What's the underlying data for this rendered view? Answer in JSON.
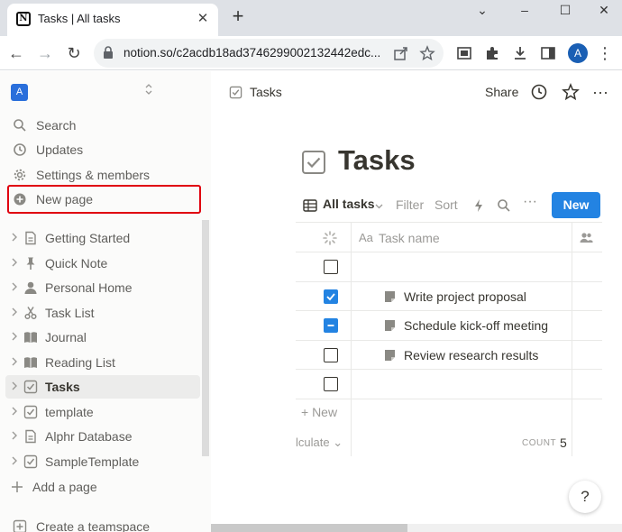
{
  "browser": {
    "tab_title": "Tasks | All tasks",
    "favicon_letter": "N",
    "url": "notion.so/c2acdb18ad3746299002132442edc...",
    "profile_initial": "A"
  },
  "sidebar": {
    "workspace_initial": "A",
    "workspace_switch": "⌃⌄",
    "menu": [
      {
        "label": "Search",
        "icon": "search-icon"
      },
      {
        "label": "Updates",
        "icon": "clock-icon"
      },
      {
        "label": "Settings & members",
        "icon": "gear-icon"
      },
      {
        "label": "New page",
        "icon": "plus-circle-icon"
      }
    ],
    "pages": [
      {
        "label": "Getting Started",
        "icon": "document-icon"
      },
      {
        "label": "Quick Note",
        "icon": "pin-icon"
      },
      {
        "label": "Personal Home",
        "icon": "person-icon"
      },
      {
        "label": "Task List",
        "icon": "scissors-icon"
      },
      {
        "label": "Journal",
        "icon": "book-icon"
      },
      {
        "label": "Reading List",
        "icon": "book-icon"
      },
      {
        "label": "Tasks",
        "icon": "checkbox-icon",
        "active": true
      },
      {
        "label": "template",
        "icon": "checkbox-icon"
      },
      {
        "label": "Alphr Database",
        "icon": "document-icon"
      },
      {
        "label": "SampleTemplate",
        "icon": "checkbox-icon"
      }
    ],
    "add_page": "Add a page",
    "create_teamspace": "Create a teamspace"
  },
  "main": {
    "breadcrumb": "Tasks",
    "share": "Share",
    "title": "Tasks",
    "view": {
      "tab": "All tasks",
      "filter": "Filter",
      "sort": "Sort",
      "new_button": "New"
    },
    "table": {
      "name_header": "Task name",
      "name_header_prefix": "Aa",
      "rows": [
        {
          "checked": "none",
          "name": ""
        },
        {
          "checked": "checked",
          "name": "Write project proposal"
        },
        {
          "checked": "partial",
          "name": "Schedule kick-off meeting"
        },
        {
          "checked": "none",
          "name": "Review research results"
        },
        {
          "checked": "none",
          "name": ""
        }
      ],
      "add_row": "+ New",
      "calculate": "lculate ⌄",
      "count_label": "COUNT",
      "count_value": "5"
    },
    "help": "?"
  }
}
